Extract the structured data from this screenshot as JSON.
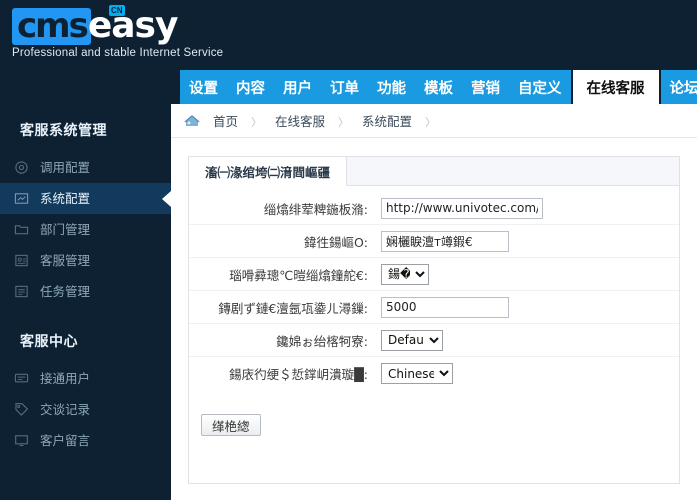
{
  "brand": {
    "cms_text": "cms",
    "easy_text": "easy",
    "badge": "CN",
    "tagline": "Professional and stable Internet Service"
  },
  "nav": {
    "items": [
      {
        "label": "设置",
        "active": false
      },
      {
        "label": "内容",
        "active": false
      },
      {
        "label": "用户",
        "active": false
      },
      {
        "label": "订单",
        "active": false
      },
      {
        "label": "功能",
        "active": false
      },
      {
        "label": "模板",
        "active": false
      },
      {
        "label": "营销",
        "active": false
      },
      {
        "label": "自定义",
        "active": false
      },
      {
        "label": "在线客服",
        "active": true
      },
      {
        "label": "论坛",
        "active": false
      }
    ]
  },
  "sidebar": {
    "group1_title": "客服系统管理",
    "group1_items": [
      {
        "label": "调用配置",
        "icon": "gear-icon",
        "active": false
      },
      {
        "label": "系统配置",
        "icon": "monitor-icon",
        "active": true
      },
      {
        "label": "部门管理",
        "icon": "folder-icon",
        "active": false
      },
      {
        "label": "客服管理",
        "icon": "id-card-icon",
        "active": false
      },
      {
        "label": "任务管理",
        "icon": "list-icon",
        "active": false
      }
    ],
    "group2_title": "客服中心",
    "group2_items": [
      {
        "label": "接通用户",
        "icon": "chat-icon",
        "active": false
      },
      {
        "label": "交谈记录",
        "icon": "tag-icon",
        "active": false
      },
      {
        "label": "客户留言",
        "icon": "screen-icon",
        "active": false
      }
    ]
  },
  "breadcrumb": {
    "home_icon": "home-icon",
    "items": [
      "首页",
      "在线客服",
      "系统配置"
    ],
    "separator": "〉"
  },
  "panel": {
    "tab_label": "滀㈠湪绾垮㈡湇閰嶇疆"
  },
  "form": {
    "rows": [
      {
        "label": "缁熻绯荤粺鍦板潃:",
        "type": "text",
        "value": "http://www.univotec.com/celive",
        "name": "site-url-field",
        "width": "w-url"
      },
      {
        "label": "鍏徃鍚嶇О:",
        "type": "text",
        "value": "娴欐睙澶т竴鍜€",
        "name": "company-name-field",
        "width": "w-mid"
      },
      {
        "label": "瑙嗗彛璁℃暟缁熻鐘舵€:",
        "type": "select",
        "value": "鍚�",
        "name": "counter-status-select",
        "width": "s-narrow"
      },
      {
        "label": "鏄剧ず鏈€澶氬瓨鍌ㄦ潯鏁:",
        "type": "text",
        "value": "5000",
        "name": "max-records-field",
        "width": "w-mid"
      },
      {
        "label": "鑱婂ぉ绐楁牱寮:",
        "type": "select",
        "value": "Default",
        "name": "chat-style-select",
        "width": "s-default"
      },
      {
        "label": "鍚庡彴绠＄悊鐣岄潰璇█:",
        "type": "select",
        "value": "Chinese",
        "name": "admin-language-select",
        "width": "s-lang"
      }
    ],
    "submit_label": "缂栬緫"
  }
}
